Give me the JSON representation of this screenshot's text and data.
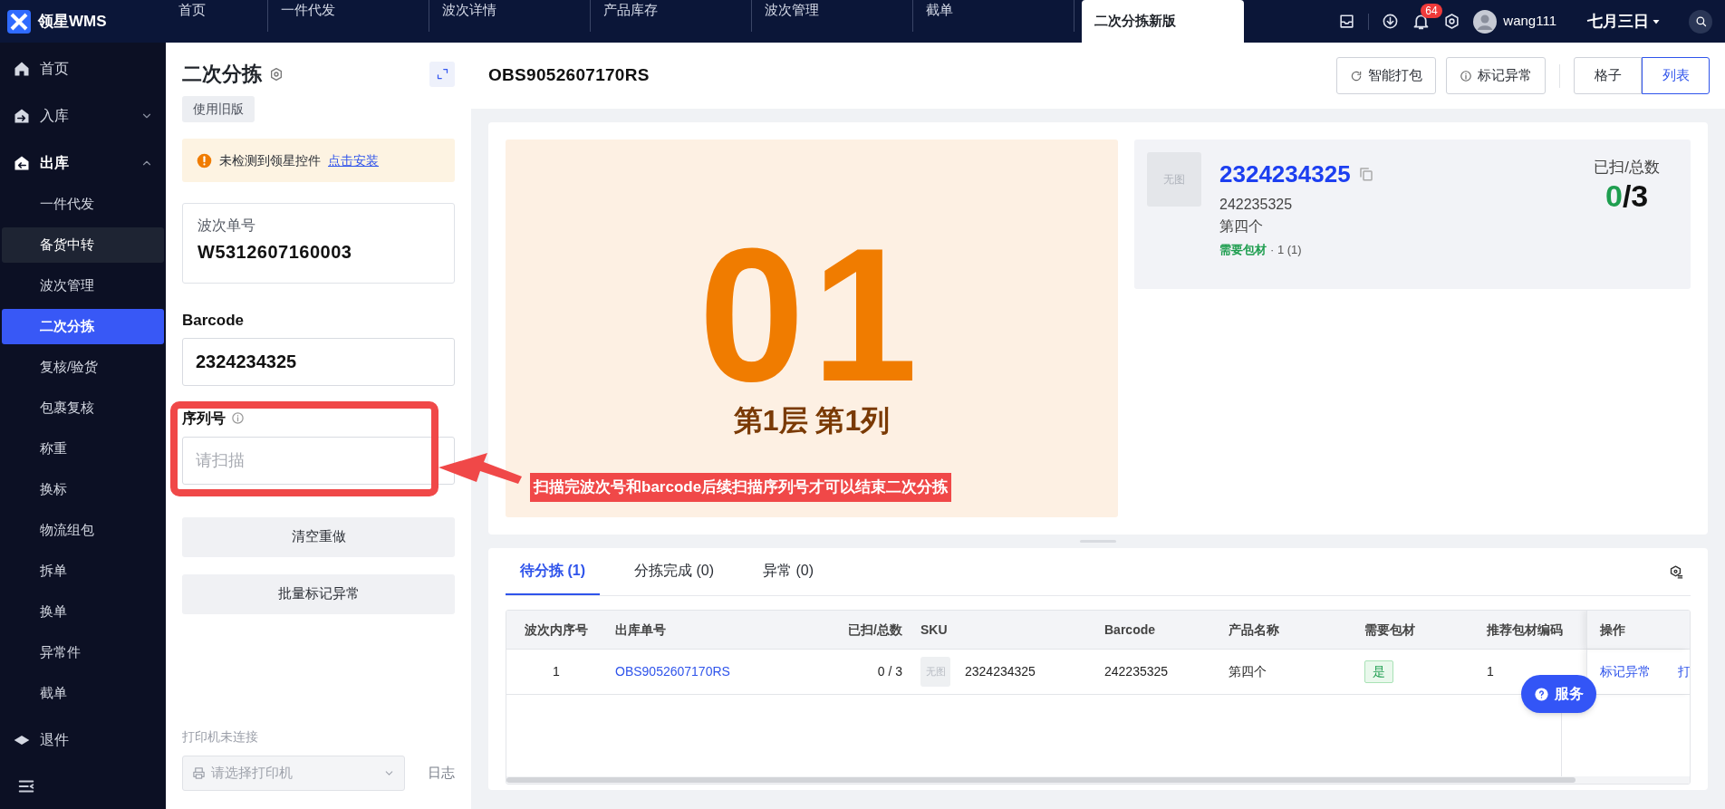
{
  "app": {
    "logo": "领星WMS"
  },
  "top_tabs": [
    {
      "label": "首页",
      "selected": false
    },
    {
      "label": "一件代发",
      "selected": false
    },
    {
      "label": "波次详情",
      "selected": false
    },
    {
      "label": "产品库存",
      "selected": false
    },
    {
      "label": "波次管理",
      "selected": false
    },
    {
      "label": "截单",
      "selected": false
    },
    {
      "label": "二次分拣新版",
      "selected": true
    }
  ],
  "top_right": {
    "notification_count": "64",
    "user": "wang111",
    "date": "七月三日"
  },
  "sidebar": {
    "items": [
      {
        "label": "首页",
        "selected": false
      },
      {
        "label": "入库",
        "expanded": false,
        "selected": false
      },
      {
        "label": "出库",
        "expanded": true,
        "selected": false,
        "children": [
          {
            "label": "一件代发",
            "selected": false,
            "hovered": false
          },
          {
            "label": "备货中转",
            "selected": false,
            "hovered": true
          },
          {
            "label": "波次管理",
            "selected": false,
            "hovered": false
          },
          {
            "label": "二次分拣",
            "selected": true,
            "hovered": false
          },
          {
            "label": "复核/验货",
            "selected": false,
            "hovered": false
          },
          {
            "label": "包裹复核",
            "selected": false,
            "hovered": false
          },
          {
            "label": "称重",
            "selected": false,
            "hovered": false
          },
          {
            "label": "换标",
            "selected": false,
            "hovered": false
          },
          {
            "label": "物流组包",
            "selected": false,
            "hovered": false
          },
          {
            "label": "拆单",
            "selected": false,
            "hovered": false
          },
          {
            "label": "换单",
            "selected": false,
            "hovered": false
          },
          {
            "label": "异常件",
            "selected": false,
            "hovered": false
          },
          {
            "label": "截单",
            "selected": false,
            "hovered": false
          }
        ]
      },
      {
        "label": "退件",
        "selected": false
      }
    ]
  },
  "left_panel": {
    "title": "二次分拣",
    "old_version_button": "使用旧版",
    "alert": {
      "text": "未检测到领星控件",
      "link": "点击安装"
    },
    "wave": {
      "label": "波次单号",
      "value": "W5312607160003"
    },
    "barcode": {
      "label": "Barcode",
      "value": "2324234325"
    },
    "serial": {
      "label": "序列号",
      "placeholder": "请扫描"
    },
    "buttons": [
      "清空重做",
      "批量标记异常"
    ],
    "printer": {
      "status": "打印机未连接",
      "placeholder": "请选择打印机",
      "log": "日志"
    }
  },
  "main": {
    "order_no": "OBS9052607170RS",
    "actions": [
      "智能打包",
      "标记异常"
    ],
    "view_toggle": [
      {
        "label": "格子",
        "selected": false
      },
      {
        "label": "列表",
        "selected": true
      }
    ],
    "slot": {
      "number": "01",
      "position": "第1层 第1列"
    },
    "item": {
      "image": "无图",
      "sku": "2324234325",
      "barcode": "242235325",
      "name": "第四个",
      "packaging": "需要包材",
      "packaging_qty": "· 1 (1)",
      "count_label": "已扫/总数",
      "scanned": "0",
      "total": "/3"
    },
    "tabs": [
      {
        "label": "待分拣 (1)",
        "selected": true
      },
      {
        "label": "分拣完成 (0)",
        "selected": false
      },
      {
        "label": "异常 (0)",
        "selected": false
      }
    ],
    "table": {
      "columns": [
        "波次内序号",
        "出库单号",
        "已扫/总数",
        "SKU",
        "Barcode",
        "产品名称",
        "需要包材",
        "推荐包材编码",
        "操作"
      ],
      "rows": [
        {
          "index": "1",
          "order_no": "OBS9052607170RS",
          "count": "0 / 3",
          "image": "无图",
          "sku": "2324234325",
          "barcode": "242235325",
          "name": "第四个",
          "needs_packaging": "是",
          "packaging_code": "1",
          "actions": [
            "标记异常",
            "打"
          ]
        }
      ]
    },
    "service_button": "服务"
  },
  "annotation": {
    "text": "扫描完波次号和barcode后续扫描序列号才可以结束二次分拣"
  }
}
